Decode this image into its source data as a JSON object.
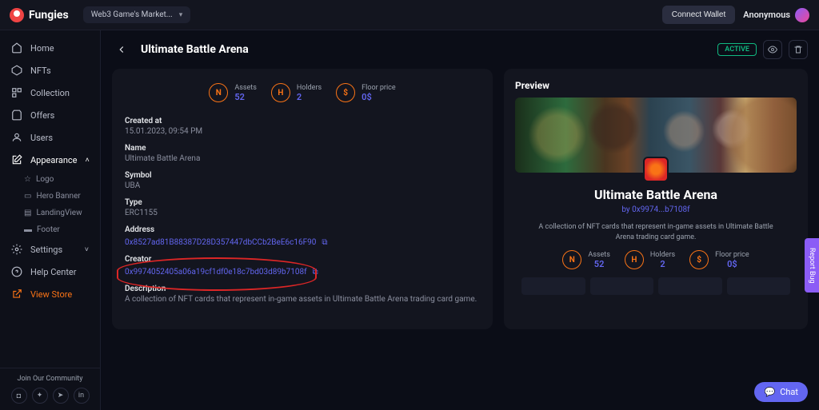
{
  "brand": "Fungies",
  "project_selector": "Web3 Game's Market...",
  "topbar": {
    "connect_wallet": "Connect Wallet",
    "user_name": "Anonymous"
  },
  "sidebar": {
    "items": [
      {
        "label": "Home"
      },
      {
        "label": "NFTs"
      },
      {
        "label": "Collection"
      },
      {
        "label": "Offers"
      },
      {
        "label": "Users"
      },
      {
        "label": "Appearance",
        "expanded": true,
        "children": [
          {
            "label": "Logo"
          },
          {
            "label": "Hero Banner"
          },
          {
            "label": "LandingView"
          },
          {
            "label": "Footer"
          }
        ]
      },
      {
        "label": "Settings"
      },
      {
        "label": "Help Center"
      },
      {
        "label": "View Store"
      }
    ],
    "community_label": "Join Our Community"
  },
  "page": {
    "title": "Ultimate Battle Arena",
    "status_badge": "ACTIVE"
  },
  "stats": {
    "assets_label": "Assets",
    "assets_value": "52",
    "holders_label": "Holders",
    "holders_value": "2",
    "floor_label": "Floor price",
    "floor_value": "0$"
  },
  "details": {
    "created_label": "Created at",
    "created_value": "15.01.2023, 09:54 PM",
    "name_label": "Name",
    "name_value": "Ultimate Battle Arena",
    "symbol_label": "Symbol",
    "symbol_value": "UBA",
    "type_label": "Type",
    "type_value": "ERC1155",
    "address_label": "Address",
    "address_value": "0x8527ad81B88387D28D357447dbCCb2BeE6c16F90",
    "creator_label": "Creator",
    "creator_value": "0x9974052405a06a19cf1df0e18c7bd03d89b7108f",
    "description_label": "Description",
    "description_value": "A collection of NFT cards that represent in-game assets in Ultimate Battle Arena trading card game."
  },
  "preview": {
    "section_title": "Preview",
    "title": "Ultimate Battle Arena",
    "by_prefix": "by ",
    "by_author": "0x9974...b7108f",
    "description": "A collection of NFT cards that represent in-game assets in Ultimate Battle Arena trading card game."
  },
  "misc": {
    "chat_label": "Chat",
    "bug_label": "Report Bug"
  }
}
